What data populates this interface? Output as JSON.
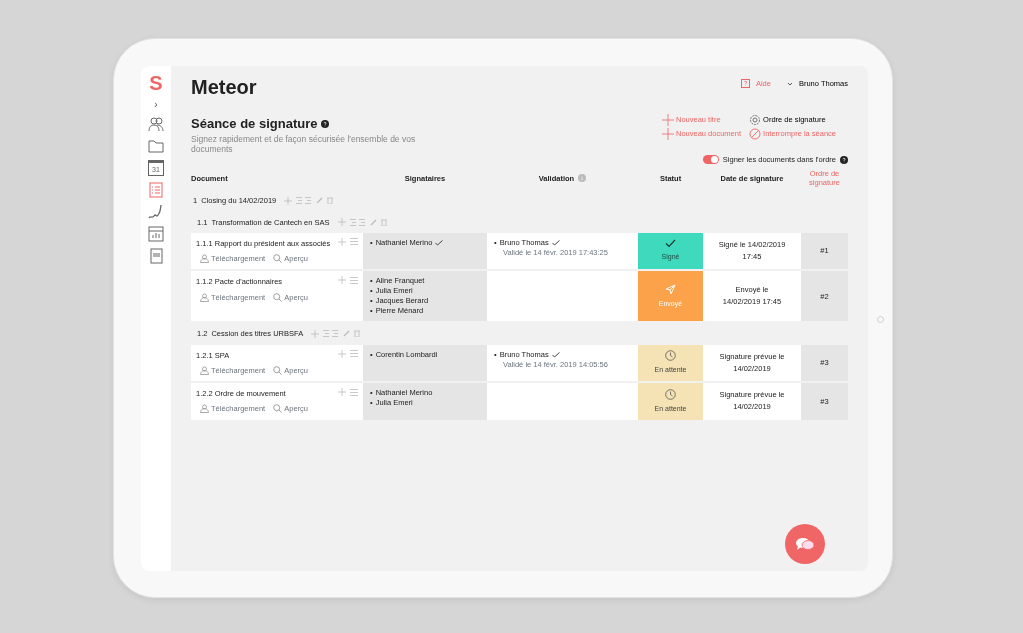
{
  "sidebar": {
    "logo": "S",
    "expand": "›",
    "items": [
      {
        "kind": "people",
        "selected": false
      },
      {
        "kind": "folder",
        "selected": false
      },
      {
        "kind": "calendar",
        "label": "31",
        "selected": false
      },
      {
        "kind": "list",
        "selected": true
      },
      {
        "kind": "signature",
        "selected": false
      },
      {
        "kind": "report",
        "selected": false
      },
      {
        "kind": "book",
        "selected": false
      }
    ]
  },
  "app_title": "Meteor",
  "header": {
    "help": "Aide",
    "user": "Bruno Thomas"
  },
  "session": {
    "title": "Séance de signature",
    "subtitle": "Signez rapidement et de façon sécurisée l'ensemble de vos documents"
  },
  "actions": [
    {
      "kind": "add",
      "label": "Nouveau titre"
    },
    {
      "kind": "settings",
      "label": "Ordre de signature"
    },
    {
      "kind": "add",
      "label": "Nouveau document"
    },
    {
      "kind": "stop",
      "label": "Interrompre la séance"
    }
  ],
  "order_toggle": {
    "label": "Signer les documents dans l'ordre",
    "on": true
  },
  "table": {
    "list_marker": "•",
    "columns": [
      {
        "label": "Document",
        "active": false
      },
      {
        "label": "Signataires",
        "active": false
      },
      {
        "label": "Validation",
        "active": false
      },
      {
        "label": "Statut",
        "active": false
      },
      {
        "label": "Date de signature",
        "active": false
      },
      {
        "label": "Ordre de signature",
        "active": true
      }
    ],
    "groups": [
      {
        "number": "1",
        "title": "Closing du 14/02/2019",
        "children": [
          {
            "number": "1.1",
            "title": "Transformation de Cantech en SAS",
            "documents": [
              {
                "title": "1.1.1 Rapport du président aux associés",
                "download": "Téléchargement",
                "preview": "Aperçu",
                "signatories": [
                  {
                    "name": "Nathaniel Merino",
                    "signed": true
                  }
                ],
                "validation": [
                  {
                    "name": "Bruno Thomas",
                    "validated": true,
                    "date": "Validé le 14 févr. 2019 17:43:25"
                  }
                ],
                "status": {
                  "kind": "signed",
                  "label": "Signé"
                },
                "date": "Signé le 14/02/2019 17:45",
                "order": "#1"
              },
              {
                "title": "1.1.2 Pacte d'actionnaires",
                "download": "Téléchargement",
                "preview": "Aperçu",
                "signatories": [
                  {
                    "name": "Aline Franquet",
                    "signed": false
                  },
                  {
                    "name": "Julia Emeri",
                    "signed": false
                  },
                  {
                    "name": "Jacques Berard",
                    "signed": false
                  },
                  {
                    "name": "Pierre Ménard",
                    "signed": false
                  }
                ],
                "status": {
                  "kind": "sent",
                  "label": "Envoyé"
                },
                "date": "Envoyé le 14/02/2019 17:45",
                "order": "#2"
              }
            ]
          },
          {
            "number": "1.2",
            "title": "Cession des titres URBSFA",
            "documents": [
              {
                "title": "1.2.1 SPA",
                "download": "Téléchargement",
                "preview": "Aperçu",
                "signatories": [
                  {
                    "name": "Corentin Lombardi",
                    "signed": false
                  }
                ],
                "validation": [
                  {
                    "name": "Bruno Thomas",
                    "validated": true,
                    "date": "Validé le 14 févr. 2019 14:05:56"
                  }
                ],
                "status": {
                  "kind": "pending",
                  "label": "En attente"
                },
                "date": "Signature prévue le 14/02/2019",
                "order": "#3"
              },
              {
                "title": "1.2.2 Ordre de mouvement",
                "download": "Téléchargement",
                "preview": "Aperçu",
                "signatories": [
                  {
                    "name": "Nathaniel Merino",
                    "signed": false
                  },
                  {
                    "name": "Julia Emeri",
                    "signed": false
                  }
                ],
                "status": {
                  "kind": "pending",
                  "label": "En attente"
                },
                "date": "Signature prévue le 14/02/2019",
                "order": "#3"
              }
            ]
          }
        ]
      }
    ]
  }
}
